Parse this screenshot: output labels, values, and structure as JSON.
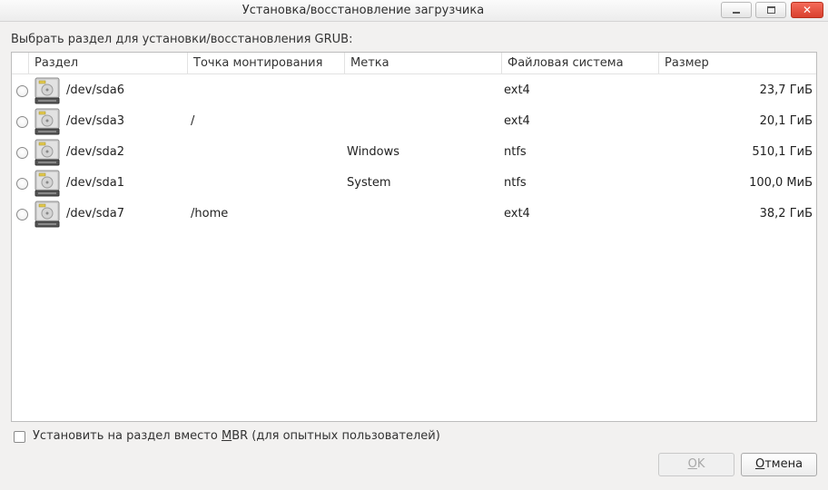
{
  "window": {
    "title": "Установка/восстановление загрузчика",
    "controls": {
      "minimize_icon": "minimize-icon",
      "maximize_icon": "maximize-icon",
      "close_icon": "close-icon",
      "close_color": "#e4503c"
    }
  },
  "prompt": "Выбрать раздел для установки/восстановления GRUB:",
  "table": {
    "columns": [
      "Раздел",
      "Точка монтирования",
      "Метка",
      "Файловая система",
      "Размер"
    ],
    "rows": [
      {
        "partition": "/dev/sda6",
        "mount": "",
        "label": "",
        "fs": "ext4",
        "size": "23,7 ГиБ",
        "icon": "hard-disk-icon"
      },
      {
        "partition": "/dev/sda3",
        "mount": "/",
        "label": "",
        "fs": "ext4",
        "size": "20,1 ГиБ",
        "icon": "hard-disk-icon"
      },
      {
        "partition": "/dev/sda2",
        "mount": "",
        "label": "Windows",
        "fs": "ntfs",
        "size": "510,1 ГиБ",
        "icon": "hard-disk-icon"
      },
      {
        "partition": "/dev/sda1",
        "mount": "",
        "label": "System",
        "fs": "ntfs",
        "size": "100,0 МиБ",
        "icon": "hard-disk-icon"
      },
      {
        "partition": "/dev/sda7",
        "mount": "/home",
        "label": "",
        "fs": "ext4",
        "size": "38,2 ГиБ",
        "icon": "hard-disk-icon"
      }
    ]
  },
  "option": {
    "label_before": "Установить на раздел вместо ",
    "label_mnemonic": "M",
    "label_after": "BR (для опытных пользователей)",
    "checked": false
  },
  "buttons": {
    "ok_mnemonic": "O",
    "ok_rest": "K",
    "ok_enabled": false,
    "cancel_mnemonic": "О",
    "cancel_rest": "тмена"
  }
}
